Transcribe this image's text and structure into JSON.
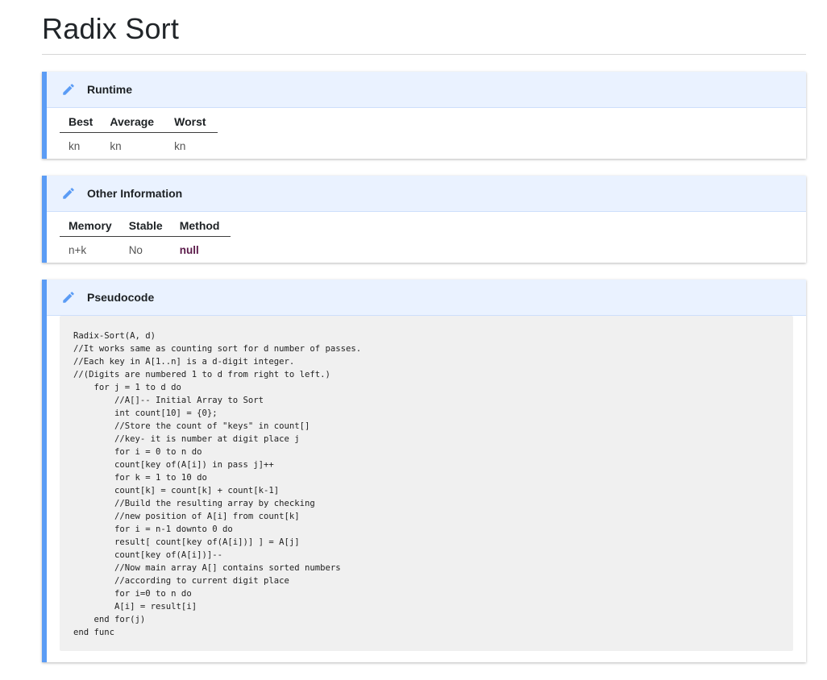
{
  "page": {
    "title": "Radix Sort"
  },
  "runtime": {
    "heading": "Runtime",
    "icon": "pencil-icon",
    "headers": [
      "Best",
      "Average",
      "Worst"
    ],
    "values": [
      "kn",
      "kn",
      "kn"
    ]
  },
  "other": {
    "heading": "Other Information",
    "icon": "pencil-icon",
    "headers": [
      "Memory",
      "Stable",
      "Method"
    ],
    "values": [
      "n+k",
      "No",
      "null"
    ]
  },
  "pseudocode": {
    "heading": "Pseudocode",
    "icon": "pencil-icon",
    "code": "Radix-Sort(A, d)\n//It works same as counting sort for d number of passes.\n//Each key in A[1..n] is a d-digit integer.\n//(Digits are numbered 1 to d from right to left.)\n    for j = 1 to d do\n        //A[]-- Initial Array to Sort\n        int count[10] = {0};\n        //Store the count of \"keys\" in count[]\n        //key- it is number at digit place j\n        for i = 0 to n do\n        count[key of(A[i]) in pass j]++\n        for k = 1 to 10 do\n        count[k] = count[k] + count[k-1]\n        //Build the resulting array by checking\n        //new position of A[i] from count[k]\n        for i = n-1 downto 0 do\n        result[ count[key of(A[i])] ] = A[j]\n        count[key of(A[i])]--\n        //Now main array A[] contains sorted numbers\n        //according to current digit place\n        for i=0 to n do\n        A[i] = result[i]\n    end for(j)\nend func"
  },
  "colors": {
    "accent": "#5b9cf5",
    "header_bg": "#eaf2ff",
    "code_bg": "#f0f0f0",
    "null_text": "#5b1a4a"
  }
}
